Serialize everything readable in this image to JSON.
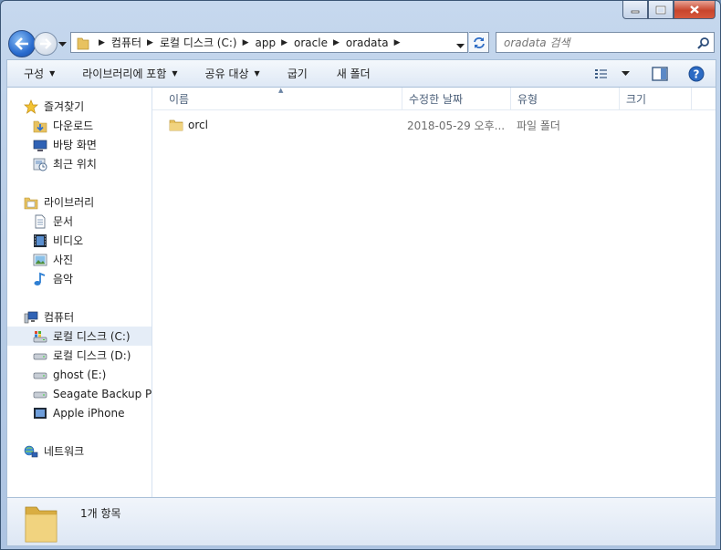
{
  "window": {
    "caption_buttons": [
      "minimize",
      "maximize",
      "close"
    ]
  },
  "nav": {
    "back_icon": "back-arrow-icon",
    "forward_icon": "forward-arrow-icon",
    "breadcrumb": [
      "컴퓨터",
      "로컬 디스크 (C:)",
      "app",
      "oracle",
      "oradata"
    ],
    "search_placeholder": "oradata 검색"
  },
  "toolbar": {
    "organize": "구성",
    "include_library": "라이브러리에 포함",
    "share_with": "공유 대상",
    "burn": "굽기",
    "new_folder": "새 폴더"
  },
  "sidebar": {
    "favorites": {
      "label": "즐겨찾기",
      "items": [
        "다운로드",
        "바탕 화면",
        "최근 위치"
      ]
    },
    "libraries": {
      "label": "라이브러리",
      "items": [
        "문서",
        "비디오",
        "사진",
        "음악"
      ]
    },
    "computer": {
      "label": "컴퓨터",
      "items": [
        "로컬 디스크 (C:)",
        "로컬 디스크 (D:)",
        "ghost (E:)",
        "Seagate Backup Plu",
        "Apple iPhone"
      ],
      "selected": "로컬 디스크 (C:)"
    },
    "network": {
      "label": "네트워크"
    }
  },
  "columns": {
    "name": "이름",
    "date": "수정한 날짜",
    "type": "유형",
    "size": "크기"
  },
  "files": [
    {
      "name": "orcl",
      "date": "2018-05-29 오후...",
      "type": "파일 폴더",
      "size": ""
    }
  ],
  "status": {
    "count": "1개 항목"
  },
  "colors": {
    "frame": "#b9cde6",
    "selection": "#e5edf7",
    "header_text": "#4c607a"
  }
}
